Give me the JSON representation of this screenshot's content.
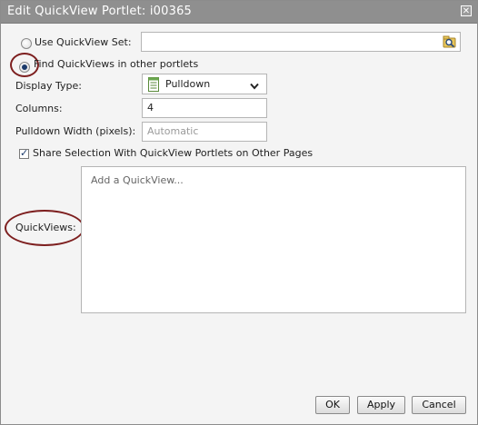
{
  "dialog": {
    "title": "Edit QuickView Portlet: i00365",
    "close_label": "✕"
  },
  "form": {
    "use_set_label": "Use QuickView Set:",
    "use_set_value": "",
    "find_label": "Find QuickViews in other portlets",
    "display_type_label": "Display Type:",
    "display_type_value": "Pulldown",
    "columns_label": "Columns:",
    "columns_value": "4",
    "pulldown_width_label": "Pulldown Width (pixels):",
    "pulldown_width_placeholder": "Automatic",
    "share_label": "Share Selection With QuickView Portlets on Other Pages",
    "share_checked": true,
    "quickviews_label": "QuickViews:",
    "quickviews_placeholder": "Add a QuickView..."
  },
  "footer": {
    "ok_label": "OK",
    "apply_label": "Apply",
    "cancel_label": "Cancel"
  },
  "colors": {
    "titlebar": "#8f8f8f",
    "annotation": "#7d1f1f",
    "radio_selected": "#1b3a6b"
  },
  "icons": {
    "browse": "magnifier-folder-icon",
    "display_type": "document-list-icon",
    "dropdown": "chevron-down-icon"
  }
}
